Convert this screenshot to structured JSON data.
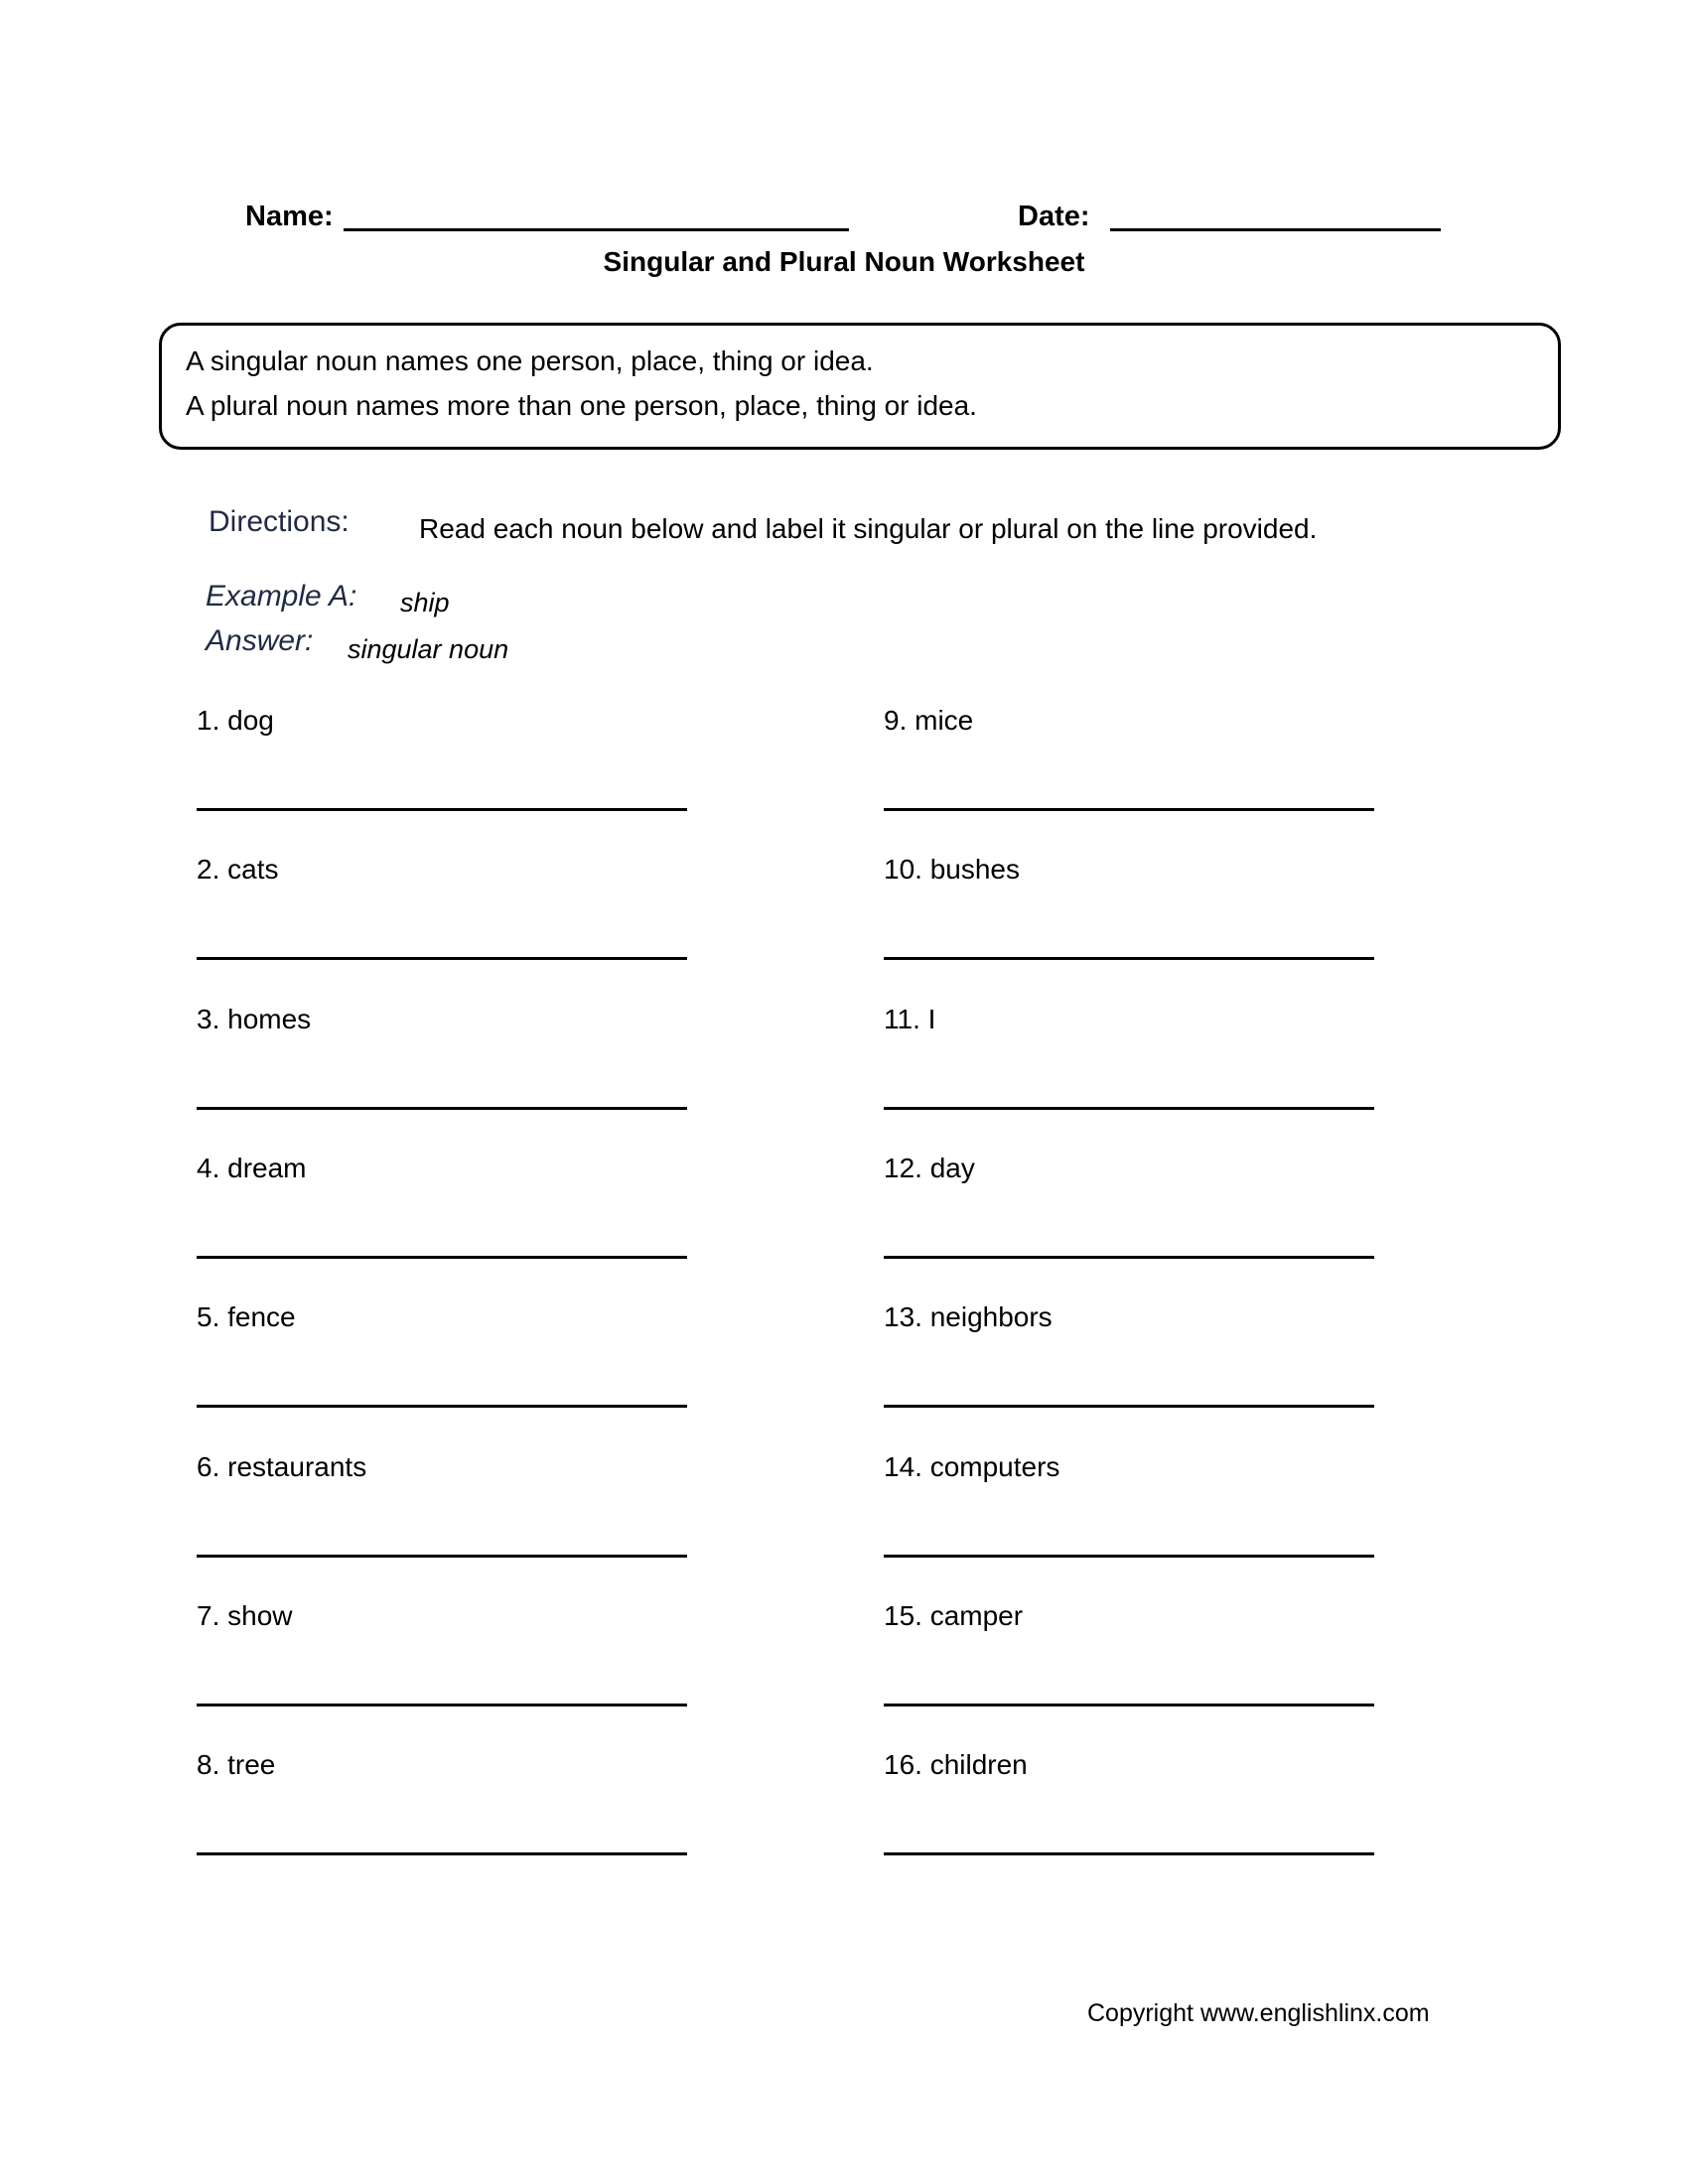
{
  "header": {
    "name_label": "Name:",
    "date_label": "Date:",
    "title": "Singular and Plural Noun Worksheet"
  },
  "definitions": [
    "A singular noun names one person, place, thing or idea.",
    "A plural noun names more than one person, place, thing or idea."
  ],
  "directions": {
    "label": "Directions:",
    "text": "Read each noun below and label it singular or plural on the line provided."
  },
  "example": {
    "label": "Example A:",
    "word": "ship",
    "answer_label": "Answer:",
    "answer": "singular noun"
  },
  "items": {
    "left": [
      "1. dog",
      "2. cats",
      "3. homes",
      "4. dream",
      "5. fence",
      "6. restaurants",
      "7. show",
      "8. tree"
    ],
    "right": [
      "9. mice",
      "10. bushes",
      "11. I",
      "12. day",
      "13. neighbors",
      "14. computers",
      "15. camper",
      "16. children"
    ]
  },
  "footer": {
    "copyright": "Copyright www.englishlinx.com"
  }
}
